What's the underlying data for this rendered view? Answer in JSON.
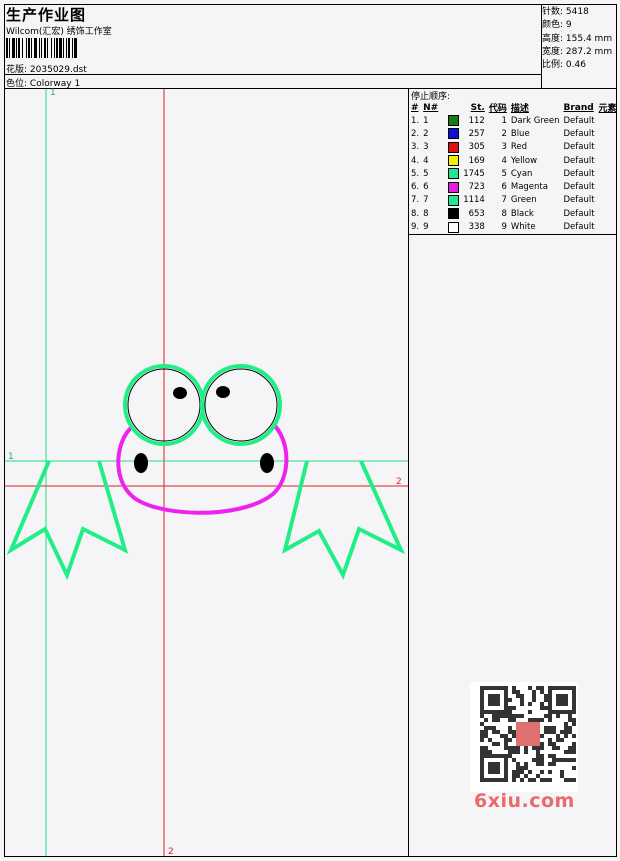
{
  "header": {
    "title": "生产作业图",
    "subtitle": "Wilcom(汇宏) 绣饰工作室",
    "pattern_label": "花版:",
    "pattern_value": "2035029.dst",
    "colorway_label": "色位:",
    "colorway_value": "Colorway 1"
  },
  "stats": {
    "stitches_label": "针数:",
    "stitches_value": "5418",
    "colors_label": "颜色:",
    "colors_value": "9",
    "height_label": "高度:",
    "height_value": "155.4 mm",
    "width_label": "宽度:",
    "width_value": "287.2 mm",
    "scale_label": "比例:",
    "scale_value": "0.46"
  },
  "stop_sequence": {
    "title": "停止顺序:",
    "headers": [
      "#",
      "N#",
      "St.",
      "代码",
      "描述",
      "Brand",
      "元素"
    ],
    "rows": [
      {
        "num": "1.",
        "n": "1",
        "color": "#1a7a1a",
        "st": "112",
        "code": "1",
        "desc": "Dark Green",
        "brand": "Default"
      },
      {
        "num": "2.",
        "n": "2",
        "color": "#1010d0",
        "st": "257",
        "code": "2",
        "desc": "Blue",
        "brand": "Default"
      },
      {
        "num": "3.",
        "n": "3",
        "color": "#e01010",
        "st": "305",
        "code": "3",
        "desc": "Red",
        "brand": "Default"
      },
      {
        "num": "4.",
        "n": "4",
        "color": "#f0f000",
        "st": "169",
        "code": "4",
        "desc": "Yellow",
        "brand": "Default"
      },
      {
        "num": "5.",
        "n": "5",
        "color": "#20e890",
        "st": "1745",
        "code": "5",
        "desc": "Cyan",
        "brand": "Default"
      },
      {
        "num": "6.",
        "n": "6",
        "color": "#e020e0",
        "st": "723",
        "code": "6",
        "desc": "Magenta",
        "brand": "Default"
      },
      {
        "num": "7.",
        "n": "7",
        "color": "#20e890",
        "st": "1114",
        "code": "7",
        "desc": "Green",
        "brand": "Default"
      },
      {
        "num": "8.",
        "n": "8",
        "color": "#000000",
        "st": "653",
        "code": "8",
        "desc": "Black",
        "brand": "Default"
      },
      {
        "num": "9.",
        "n": "9",
        "color": "#ffffff",
        "st": "338",
        "code": "9",
        "desc": "White",
        "brand": "Default"
      }
    ]
  },
  "design": {
    "axis_labels": {
      "v1": "1",
      "h1": "1",
      "h2": "2",
      "v2": "2"
    },
    "colors": {
      "outline_green": "#22ee88",
      "magenta": "#ee22ee",
      "red_axis": "#e02020",
      "green_axis": "#22dd88"
    }
  },
  "watermark": {
    "site": "6xiu.com"
  }
}
